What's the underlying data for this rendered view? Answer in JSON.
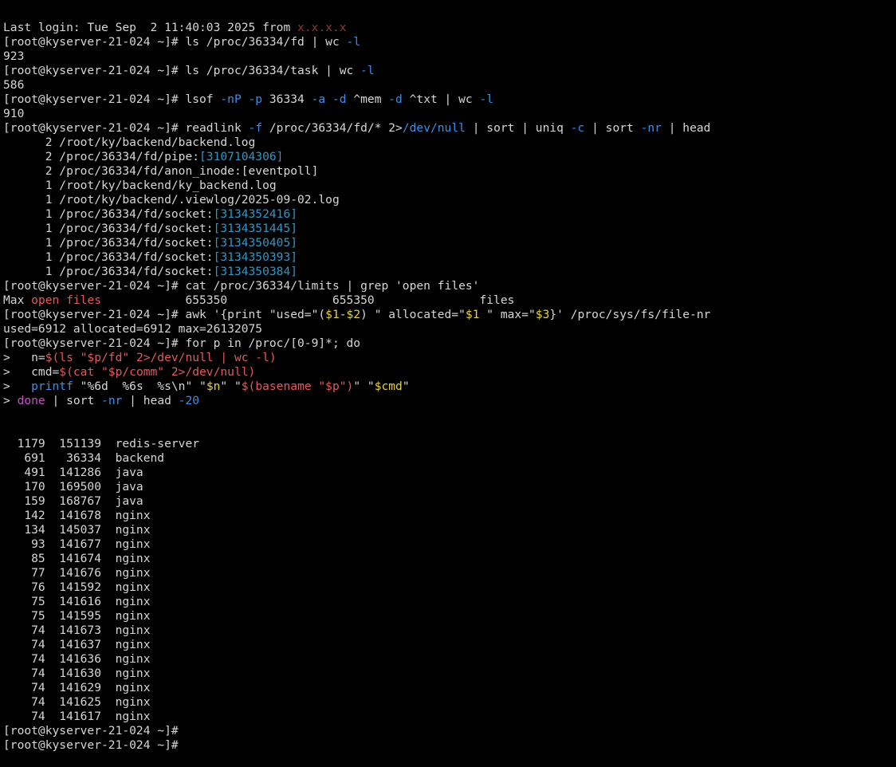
{
  "terminal": {
    "colors": {
      "fg": "#d6d6d6",
      "bg": "#000000",
      "flag": "#3b8eea",
      "path": "#2f97c7",
      "red": "#e05b5b",
      "var": "#e5d33a",
      "keyword": "#c94fc9",
      "dim": "#8a3a3a"
    },
    "lines": [
      [
        {
          "t": "Last login: Tue Sep  2 11:40:03 2025 from ",
          "c": "fg"
        },
        {
          "t": "x.x.x.x",
          "c": "dim"
        }
      ],
      [
        {
          "t": "[root@kyserver-21-024 ~]# ls /proc/36334/fd | wc ",
          "c": "fg"
        },
        {
          "t": "-l",
          "c": "flag"
        }
      ],
      [
        {
          "t": "923",
          "c": "fg"
        }
      ],
      [
        {
          "t": "[root@kyserver-21-024 ~]# ls /proc/36334/task | wc ",
          "c": "fg"
        },
        {
          "t": "-l",
          "c": "flag"
        }
      ],
      [
        {
          "t": "586",
          "c": "fg"
        }
      ],
      [
        {
          "t": "[root@kyserver-21-024 ~]# lsof ",
          "c": "fg"
        },
        {
          "t": "-nP -p",
          "c": "flag"
        },
        {
          "t": " 36334 ",
          "c": "fg"
        },
        {
          "t": "-a -d",
          "c": "flag"
        },
        {
          "t": " ^mem ",
          "c": "fg"
        },
        {
          "t": "-d",
          "c": "flag"
        },
        {
          "t": " ^txt | wc ",
          "c": "fg"
        },
        {
          "t": "-l",
          "c": "flag"
        }
      ],
      [
        {
          "t": "910",
          "c": "fg"
        }
      ],
      [
        {
          "t": "[root@kyserver-21-024 ~]# readlink ",
          "c": "fg"
        },
        {
          "t": "-f",
          "c": "flag"
        },
        {
          "t": " /proc/36334/fd/* 2>",
          "c": "fg"
        },
        {
          "t": "/dev/null",
          "c": "flag"
        },
        {
          "t": " | sort | uniq ",
          "c": "fg"
        },
        {
          "t": "-c",
          "c": "flag"
        },
        {
          "t": " | sort ",
          "c": "fg"
        },
        {
          "t": "-nr",
          "c": "flag"
        },
        {
          "t": " | head",
          "c": "fg"
        }
      ],
      [
        {
          "t": "      2 /root/ky/backend/backend.log",
          "c": "fg"
        }
      ],
      [
        {
          "t": "      2 /proc/36334/fd/pipe:",
          "c": "fg"
        },
        {
          "t": "[3107104306]",
          "c": "path"
        }
      ],
      [
        {
          "t": "      2 /proc/36334/fd/anon_inode:[eventpoll]",
          "c": "fg"
        }
      ],
      [
        {
          "t": "      1 /root/ky/backend/ky_backend.log",
          "c": "fg"
        }
      ],
      [
        {
          "t": "      1 /root/ky/backend/.viewlog/2025-09-02.log",
          "c": "fg"
        }
      ],
      [
        {
          "t": "      1 /proc/36334/fd/socket:",
          "c": "fg"
        },
        {
          "t": "[3134352416]",
          "c": "path"
        }
      ],
      [
        {
          "t": "      1 /proc/36334/fd/socket:",
          "c": "fg"
        },
        {
          "t": "[3134351445]",
          "c": "path"
        }
      ],
      [
        {
          "t": "      1 /proc/36334/fd/socket:",
          "c": "fg"
        },
        {
          "t": "[3134350405]",
          "c": "path"
        }
      ],
      [
        {
          "t": "      1 /proc/36334/fd/socket:",
          "c": "fg"
        },
        {
          "t": "[3134350393]",
          "c": "path"
        }
      ],
      [
        {
          "t": "      1 /proc/36334/fd/socket:",
          "c": "fg"
        },
        {
          "t": "[3134350384]",
          "c": "path"
        }
      ],
      [
        {
          "t": "[root@kyserver-21-024 ~]# cat /proc/36334/limits | grep 'open files'",
          "c": "fg"
        }
      ],
      [
        {
          "t": "Max ",
          "c": "fg"
        },
        {
          "t": "open files",
          "c": "red"
        },
        {
          "t": "            655350               655350               files",
          "c": "fg"
        }
      ],
      [
        {
          "t": "[root@kyserver-21-024 ~]# awk '{print \"used=\"(",
          "c": "fg"
        },
        {
          "t": "$1",
          "c": "var"
        },
        {
          "t": "-",
          "c": "fg"
        },
        {
          "t": "$2",
          "c": "var"
        },
        {
          "t": ") \" allocated=\"",
          "c": "fg"
        },
        {
          "t": "$1",
          "c": "var"
        },
        {
          "t": " \" max=\"",
          "c": "fg"
        },
        {
          "t": "$3",
          "c": "var"
        },
        {
          "t": "}' /proc/sys/fs/file-nr",
          "c": "fg"
        }
      ],
      [
        {
          "t": "used=6912 allocated=6912 max=26132075",
          "c": "fg"
        }
      ],
      [
        {
          "t": "[root@kyserver-21-024 ~]# for p in /proc/[0-9]*; do",
          "c": "fg"
        }
      ],
      [
        {
          "t": ">   n=",
          "c": "fg"
        },
        {
          "t": "$(ls \"$p/fd\" 2>/dev/null | wc -l)",
          "c": "red"
        }
      ],
      [
        {
          "t": ">   cmd=",
          "c": "fg"
        },
        {
          "t": "$(cat \"$p/comm\" 2>/dev/null)",
          "c": "red"
        }
      ],
      [
        {
          "t": ">   ",
          "c": "fg"
        },
        {
          "t": "printf",
          "c": "flag"
        },
        {
          "t": " \"%6d  %6s  %s\\n\" \"",
          "c": "fg"
        },
        {
          "t": "$n",
          "c": "var"
        },
        {
          "t": "\" \"",
          "c": "fg"
        },
        {
          "t": "$(basename \"$p\")",
          "c": "red"
        },
        {
          "t": "\" \"",
          "c": "fg"
        },
        {
          "t": "$cmd",
          "c": "var"
        },
        {
          "t": "\"",
          "c": "fg"
        }
      ],
      [
        {
          "t": "> ",
          "c": "fg"
        },
        {
          "t": "done",
          "c": "keyword"
        },
        {
          "t": " | sort ",
          "c": "fg"
        },
        {
          "t": "-nr",
          "c": "flag"
        },
        {
          "t": " | head ",
          "c": "fg"
        },
        {
          "t": "-20",
          "c": "flag"
        }
      ],
      [
        {
          "t": "",
          "c": "fg"
        }
      ],
      [
        {
          "t": "",
          "c": "fg"
        }
      ],
      [
        {
          "t": "  1179  151139  redis-server",
          "c": "fg"
        }
      ],
      [
        {
          "t": "   691   36334  backend",
          "c": "fg"
        }
      ],
      [
        {
          "t": "   491  141286  java",
          "c": "fg"
        }
      ],
      [
        {
          "t": "   170  169500  java",
          "c": "fg"
        }
      ],
      [
        {
          "t": "   159  168767  java",
          "c": "fg"
        }
      ],
      [
        {
          "t": "   142  141678  nginx",
          "c": "fg"
        }
      ],
      [
        {
          "t": "   134  145037  nginx",
          "c": "fg"
        }
      ],
      [
        {
          "t": "    93  141677  nginx",
          "c": "fg"
        }
      ],
      [
        {
          "t": "    85  141674  nginx",
          "c": "fg"
        }
      ],
      [
        {
          "t": "    77  141676  nginx",
          "c": "fg"
        }
      ],
      [
        {
          "t": "    76  141592  nginx",
          "c": "fg"
        }
      ],
      [
        {
          "t": "    75  141616  nginx",
          "c": "fg"
        }
      ],
      [
        {
          "t": "    75  141595  nginx",
          "c": "fg"
        }
      ],
      [
        {
          "t": "    74  141673  nginx",
          "c": "fg"
        }
      ],
      [
        {
          "t": "    74  141637  nginx",
          "c": "fg"
        }
      ],
      [
        {
          "t": "    74  141636  nginx",
          "c": "fg"
        }
      ],
      [
        {
          "t": "    74  141630  nginx",
          "c": "fg"
        }
      ],
      [
        {
          "t": "    74  141629  nginx",
          "c": "fg"
        }
      ],
      [
        {
          "t": "    74  141625  nginx",
          "c": "fg"
        }
      ],
      [
        {
          "t": "    74  141617  nginx",
          "c": "fg"
        }
      ],
      [
        {
          "t": "[root@kyserver-21-024 ~]#",
          "c": "fg"
        }
      ],
      [
        {
          "t": "[root@kyserver-21-024 ~]#",
          "c": "fg"
        }
      ]
    ]
  }
}
